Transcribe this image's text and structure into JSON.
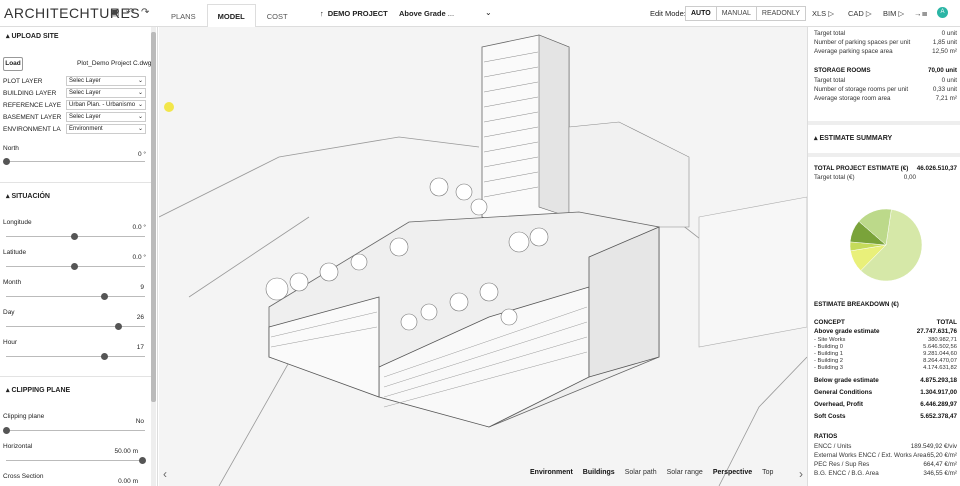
{
  "app": {
    "logo": "ARCHITECHTURES"
  },
  "toolbar": {
    "save_icon": "save-icon",
    "undo_icon": "undo-icon",
    "redo_icon": "redo-icon"
  },
  "tabs": [
    {
      "label": "PLANS"
    },
    {
      "label": "MODEL"
    },
    {
      "label": "COST"
    }
  ],
  "project": {
    "arrow": "↑",
    "name": "DEMO PROJECT",
    "level": "Above Grade",
    "ellipsis": "...",
    "chevron": "⌄"
  },
  "edit_mode": {
    "label": "Edit Mode:",
    "options": [
      "AUTO",
      "MANUAL",
      "READONLY"
    ],
    "active": "AUTO"
  },
  "exports": [
    "XLS ▷",
    "CAD ▷",
    "BIM ▷",
    "→≣"
  ],
  "avatar": "A",
  "left": {
    "upload": {
      "title": "UPLOAD SITE",
      "load": "Load",
      "file": "Plot_Demo Project C.dwg",
      "layers": [
        {
          "label": "PLOT LAYER",
          "value": "Selec Layer"
        },
        {
          "label": "BUILDING LAYER",
          "value": "Selec Layer"
        },
        {
          "label": "REFERENCE LAYE",
          "value": "Urban Plan. - Urbanismo"
        },
        {
          "label": "BASEMENT LAYER",
          "value": "Selec Layer"
        },
        {
          "label": "ENVIRONMENT LA",
          "value": "Environment"
        }
      ],
      "north_label": "North",
      "north_value": "0 °",
      "north_fraction": 0
    },
    "situacion": {
      "title": "SITUACIÓN",
      "sliders": [
        {
          "label": "Longitude",
          "value": "0.0 °",
          "fraction": 0.5
        },
        {
          "label": "Latitude",
          "value": "0.0 °",
          "fraction": 0.5
        },
        {
          "label": "Month",
          "value": "9",
          "fraction": 0.72
        },
        {
          "label": "Day",
          "value": "26",
          "fraction": 0.82
        },
        {
          "label": "Hour",
          "value": "17",
          "fraction": 0.72
        }
      ]
    },
    "clipping": {
      "title": "CLIPPING PLANE",
      "plane_label": "Clipping plane",
      "plane_value": "No",
      "sliders": [
        {
          "label": "Horizontal",
          "value": "50.00 m",
          "fraction": 1
        },
        {
          "label": "Cross Section",
          "value": "0.00 m",
          "fraction": 0
        }
      ]
    }
  },
  "viewport": {
    "bottom_tabs": [
      {
        "label": "Environment",
        "bold": true
      },
      {
        "label": "Buildings",
        "bold": true
      },
      {
        "label": "Solar path",
        "bold": false
      },
      {
        "label": "Solar range",
        "bold": false
      },
      {
        "label": "Perspective",
        "bold": true
      },
      {
        "label": "Top",
        "bold": false
      }
    ],
    "left_arrow": "‹",
    "right_arrow": "›"
  },
  "right": {
    "parking": [
      {
        "label": "Target total",
        "value": "0 unit"
      },
      {
        "label": "Number of parking spaces per unit",
        "value": "1,85 unit"
      },
      {
        "label": "Average parking space area",
        "value": "12,50 m²"
      }
    ],
    "storage": {
      "title": "STORAGE ROOMS",
      "total": "70,00 unit",
      "rows": [
        {
          "label": "Target total",
          "value": "0 unit"
        },
        {
          "label": "Number of storage rooms per unit",
          "value": "0,33 unit"
        },
        {
          "label": "Average storage room area",
          "value": "7,21 m²"
        }
      ]
    },
    "estimate": {
      "title": "ESTIMATE SUMMARY",
      "total_label": "TOTAL PROJECT ESTIMATE (€)",
      "total_value": "46.026.510,37",
      "target_label": "Target total (€)",
      "target_value": "0,00"
    },
    "pie": [
      {
        "fraction": 0.6,
        "color": "#d6e8a8"
      },
      {
        "fraction": 0.1,
        "color": "#e9f07a"
      },
      {
        "fraction": 0.04,
        "color": "#c5db5a"
      },
      {
        "fraction": 0.1,
        "color": "#7aa33a"
      },
      {
        "fraction": 0.16,
        "color": "#bcd98a"
      }
    ],
    "breakdown": {
      "title": "ESTIMATE BREAKDOWN (€)",
      "col1": "CONCEPT",
      "col2": "TOTAL",
      "rows": [
        {
          "label": "Above grade estimate",
          "value": "27.747.631,76",
          "bold": true
        },
        {
          "label": "- Site Works",
          "value": "380.982,71",
          "bold": false
        },
        {
          "label": "- Building 0",
          "value": "5.646.502,56",
          "bold": false
        },
        {
          "label": "- Building 1",
          "value": "9.281.044,60",
          "bold": false
        },
        {
          "label": "- Building 2",
          "value": "8.264.470,07",
          "bold": false
        },
        {
          "label": "- Building 3",
          "value": "4.174.631,82",
          "bold": false
        },
        {
          "label": "Below grade estimate",
          "value": "4.875.293,18",
          "bold": true
        },
        {
          "label": "General Conditions",
          "value": "1.304.917,00",
          "bold": true
        },
        {
          "label": "Overhead, Profit",
          "value": "6.446.289,97",
          "bold": true
        },
        {
          "label": "Soft Costs",
          "value": "5.652.378,47",
          "bold": true
        }
      ]
    },
    "ratios": {
      "title": "RATIOS",
      "rows": [
        {
          "label": "ENCC / Units",
          "value": "189.549,92 €/viv"
        },
        {
          "label": "External Works ENCC / Ext. Works Area",
          "value": "65,20 €/m²"
        },
        {
          "label": "PEC Res / Sup Res",
          "value": "664,47 €/m²"
        },
        {
          "label": "B.G. ENCC / B.G. Area",
          "value": "346,55 €/m²"
        }
      ]
    }
  }
}
